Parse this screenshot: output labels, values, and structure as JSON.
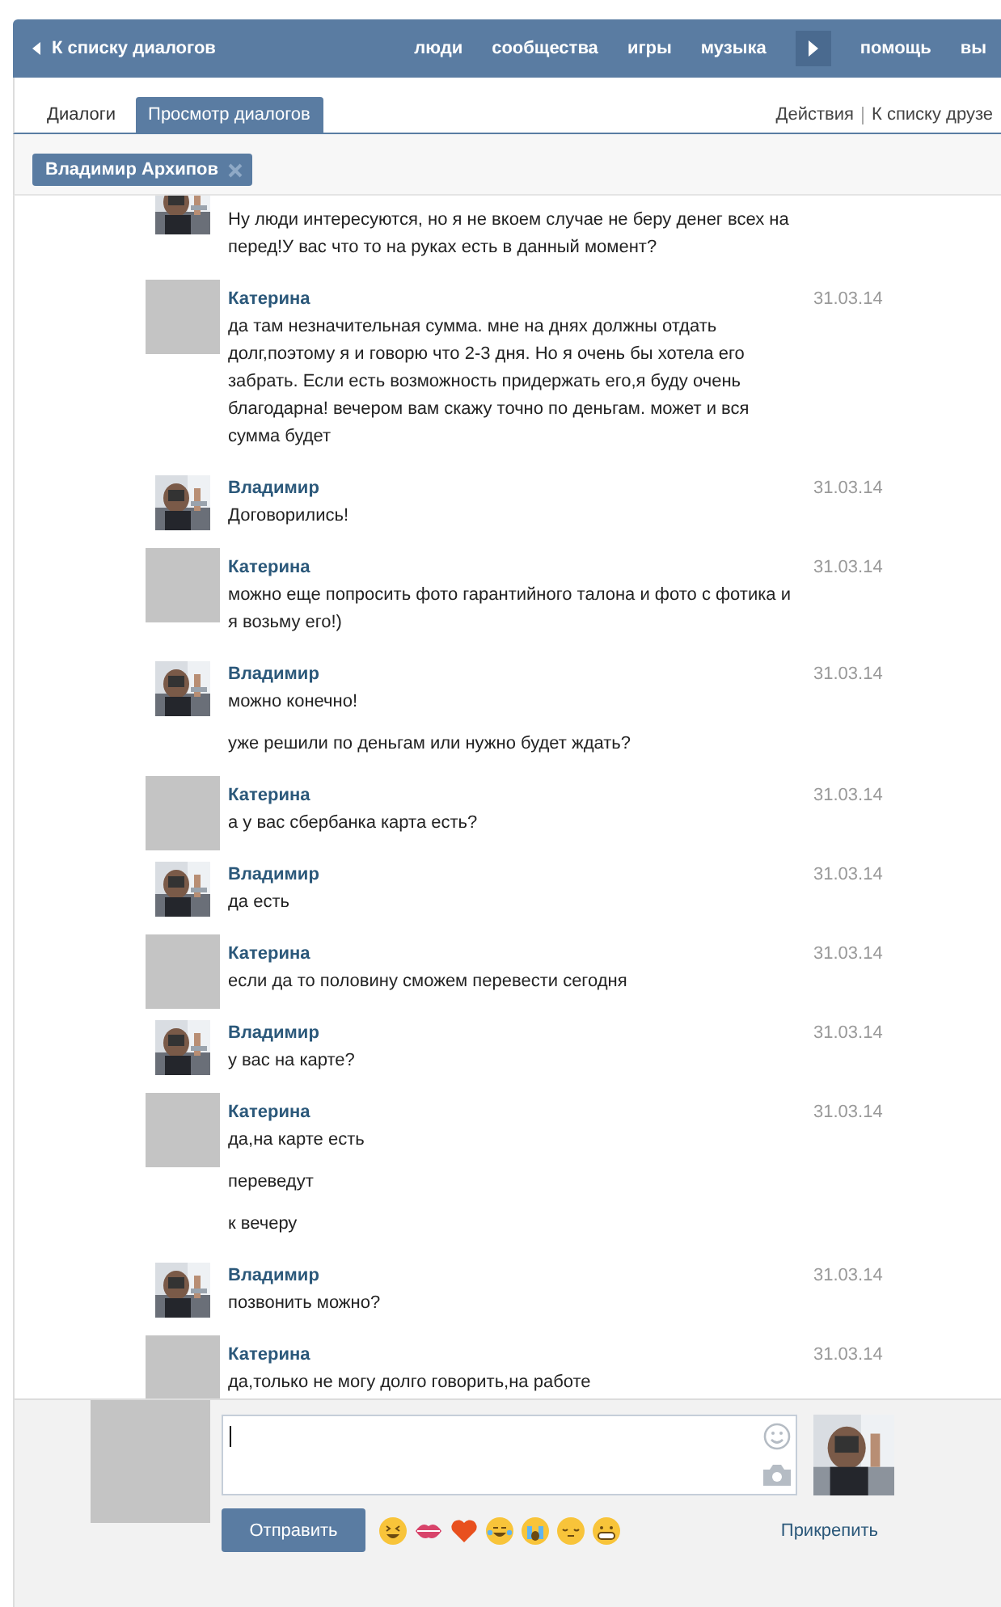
{
  "header": {
    "back_link": "К списку диалогов",
    "nav": [
      "люди",
      "сообщества",
      "игры",
      "музыка",
      "помощь",
      "вы"
    ]
  },
  "tabs": [
    {
      "label": "Диалоги",
      "selected": false
    },
    {
      "label": "Просмотр диалогов",
      "selected": true
    }
  ],
  "actions": [
    "Действия",
    "К списку друзе"
  ],
  "filter_chip": {
    "label": "Владимир Архипов"
  },
  "messages": [
    {
      "paragraphs": [
        "Ну люди интересуются, но я не вкоем случае не беру денег всех на перед!У вас что то на руках есть в данный момент?"
      ]
    },
    {
      "kind": "placeholder",
      "author": "Катерина",
      "date": "31.03.14",
      "paragraphs": [
        "да там незначительная сумма. мне на днях должны отдать долг,поэтому я и говорю что 2-3 дня. Но я очень бы хотела его забрать. Если есть возможность придержать его,я буду очень благодарна! вечером вам скажу точно по деньгам. может и вся сумма будет"
      ]
    },
    {
      "author": "Владимир",
      "date": "31.03.14",
      "paragraphs": [
        "Договорились!"
      ]
    },
    {
      "kind": "placeholder",
      "author": "Катерина",
      "date": "31.03.14",
      "paragraphs": [
        "можно еще попросить фото гарантийного талона и фото с фотика и я возьму его!)"
      ]
    },
    {
      "author": "Владимир",
      "date": "31.03.14",
      "paragraphs": [
        "можно конечно!",
        "уже решили по деньгам или нужно будет ждать?"
      ]
    },
    {
      "kind": "placeholder",
      "author": "Катерина",
      "date": "31.03.14",
      "paragraphs": [
        "а у вас сбербанка карта есть?"
      ]
    },
    {
      "author": "Владимир",
      "date": "31.03.14",
      "paragraphs": [
        "да есть"
      ]
    },
    {
      "kind": "placeholder",
      "author": "Катерина",
      "date": "31.03.14",
      "paragraphs": [
        "если да то половину сможем перевести сегодня"
      ]
    },
    {
      "author": "Владимир",
      "date": "31.03.14",
      "paragraphs": [
        "у вас на карте?"
      ]
    },
    {
      "kind": "placeholder",
      "author": "Катерина",
      "date": "31.03.14",
      "paragraphs": [
        "да,на карте есть",
        "переведут",
        "к вечеру"
      ]
    },
    {
      "author": "Владимир",
      "date": "31.03.14",
      "paragraphs": [
        "позвонить можно?"
      ]
    },
    {
      "kind": "placeholder",
      "author": "Катерина",
      "date": "31.03.14",
      "paragraphs": [
        "да,только не могу долго говорить,на работе"
      ]
    }
  ],
  "composer": {
    "send_button": "Отправить",
    "attach_link": "Прикрепить"
  }
}
